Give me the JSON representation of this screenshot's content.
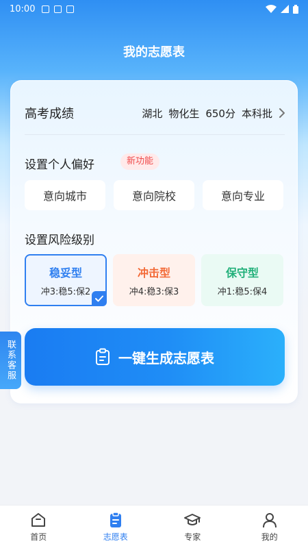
{
  "status_bar": {
    "time": "10:00"
  },
  "header": {
    "title": "我的志愿表"
  },
  "score": {
    "label": "高考成绩",
    "province": "湖北",
    "subjects": "物化生",
    "score": "650分",
    "batch": "本科批"
  },
  "preferences": {
    "title": "设置个人偏好",
    "badge": "新功能",
    "options": [
      "意向城市",
      "意向院校",
      "意向专业"
    ]
  },
  "risk": {
    "title": "设置风险级别",
    "options": [
      {
        "name": "稳妥型",
        "ratio": "冲3:稳5:保2",
        "selected": true
      },
      {
        "name": "冲击型",
        "ratio": "冲4:稳3:保3",
        "selected": false
      },
      {
        "name": "保守型",
        "ratio": "冲1:稳5:保4",
        "selected": false
      }
    ]
  },
  "generate_button": "一键生成志愿表",
  "support_tab": "联系客服",
  "tabbar": [
    {
      "label": "首页",
      "icon": "home-icon",
      "active": false
    },
    {
      "label": "志愿表",
      "icon": "clipboard-icon",
      "active": true
    },
    {
      "label": "专家",
      "icon": "graduation-cap-icon",
      "active": false
    },
    {
      "label": "我的",
      "icon": "user-icon",
      "active": false
    }
  ],
  "colors": {
    "primary": "#2f7ff0",
    "aggressive": "#f36a37",
    "conservative": "#22b07a",
    "badge_red": "#ef4b4b"
  }
}
